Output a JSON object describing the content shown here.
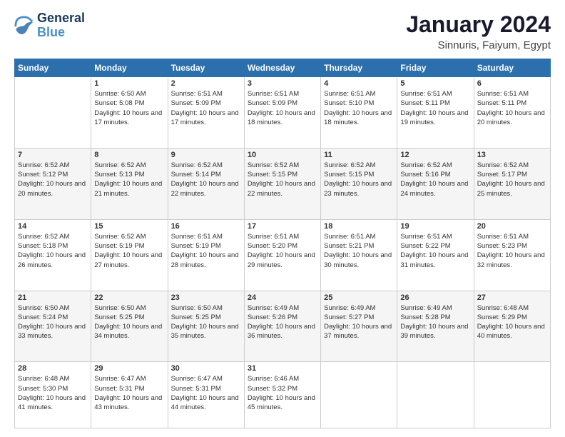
{
  "logo": {
    "line1": "General",
    "line2": "Blue"
  },
  "title": "January 2024",
  "subtitle": "Sinnuris, Faiyum, Egypt",
  "weekdays": [
    "Sunday",
    "Monday",
    "Tuesday",
    "Wednesday",
    "Thursday",
    "Friday",
    "Saturday"
  ],
  "weeks": [
    [
      {
        "day": "",
        "sunrise": "",
        "sunset": "",
        "daylight": ""
      },
      {
        "day": "1",
        "sunrise": "Sunrise: 6:50 AM",
        "sunset": "Sunset: 5:08 PM",
        "daylight": "Daylight: 10 hours and 17 minutes."
      },
      {
        "day": "2",
        "sunrise": "Sunrise: 6:51 AM",
        "sunset": "Sunset: 5:09 PM",
        "daylight": "Daylight: 10 hours and 17 minutes."
      },
      {
        "day": "3",
        "sunrise": "Sunrise: 6:51 AM",
        "sunset": "Sunset: 5:09 PM",
        "daylight": "Daylight: 10 hours and 18 minutes."
      },
      {
        "day": "4",
        "sunrise": "Sunrise: 6:51 AM",
        "sunset": "Sunset: 5:10 PM",
        "daylight": "Daylight: 10 hours and 18 minutes."
      },
      {
        "day": "5",
        "sunrise": "Sunrise: 6:51 AM",
        "sunset": "Sunset: 5:11 PM",
        "daylight": "Daylight: 10 hours and 19 minutes."
      },
      {
        "day": "6",
        "sunrise": "Sunrise: 6:51 AM",
        "sunset": "Sunset: 5:11 PM",
        "daylight": "Daylight: 10 hours and 20 minutes."
      }
    ],
    [
      {
        "day": "7",
        "sunrise": "Sunrise: 6:52 AM",
        "sunset": "Sunset: 5:12 PM",
        "daylight": "Daylight: 10 hours and 20 minutes."
      },
      {
        "day": "8",
        "sunrise": "Sunrise: 6:52 AM",
        "sunset": "Sunset: 5:13 PM",
        "daylight": "Daylight: 10 hours and 21 minutes."
      },
      {
        "day": "9",
        "sunrise": "Sunrise: 6:52 AM",
        "sunset": "Sunset: 5:14 PM",
        "daylight": "Daylight: 10 hours and 22 minutes."
      },
      {
        "day": "10",
        "sunrise": "Sunrise: 6:52 AM",
        "sunset": "Sunset: 5:15 PM",
        "daylight": "Daylight: 10 hours and 22 minutes."
      },
      {
        "day": "11",
        "sunrise": "Sunrise: 6:52 AM",
        "sunset": "Sunset: 5:15 PM",
        "daylight": "Daylight: 10 hours and 23 minutes."
      },
      {
        "day": "12",
        "sunrise": "Sunrise: 6:52 AM",
        "sunset": "Sunset: 5:16 PM",
        "daylight": "Daylight: 10 hours and 24 minutes."
      },
      {
        "day": "13",
        "sunrise": "Sunrise: 6:52 AM",
        "sunset": "Sunset: 5:17 PM",
        "daylight": "Daylight: 10 hours and 25 minutes."
      }
    ],
    [
      {
        "day": "14",
        "sunrise": "Sunrise: 6:52 AM",
        "sunset": "Sunset: 5:18 PM",
        "daylight": "Daylight: 10 hours and 26 minutes."
      },
      {
        "day": "15",
        "sunrise": "Sunrise: 6:52 AM",
        "sunset": "Sunset: 5:19 PM",
        "daylight": "Daylight: 10 hours and 27 minutes."
      },
      {
        "day": "16",
        "sunrise": "Sunrise: 6:51 AM",
        "sunset": "Sunset: 5:19 PM",
        "daylight": "Daylight: 10 hours and 28 minutes."
      },
      {
        "day": "17",
        "sunrise": "Sunrise: 6:51 AM",
        "sunset": "Sunset: 5:20 PM",
        "daylight": "Daylight: 10 hours and 29 minutes."
      },
      {
        "day": "18",
        "sunrise": "Sunrise: 6:51 AM",
        "sunset": "Sunset: 5:21 PM",
        "daylight": "Daylight: 10 hours and 30 minutes."
      },
      {
        "day": "19",
        "sunrise": "Sunrise: 6:51 AM",
        "sunset": "Sunset: 5:22 PM",
        "daylight": "Daylight: 10 hours and 31 minutes."
      },
      {
        "day": "20",
        "sunrise": "Sunrise: 6:51 AM",
        "sunset": "Sunset: 5:23 PM",
        "daylight": "Daylight: 10 hours and 32 minutes."
      }
    ],
    [
      {
        "day": "21",
        "sunrise": "Sunrise: 6:50 AM",
        "sunset": "Sunset: 5:24 PM",
        "daylight": "Daylight: 10 hours and 33 minutes."
      },
      {
        "day": "22",
        "sunrise": "Sunrise: 6:50 AM",
        "sunset": "Sunset: 5:25 PM",
        "daylight": "Daylight: 10 hours and 34 minutes."
      },
      {
        "day": "23",
        "sunrise": "Sunrise: 6:50 AM",
        "sunset": "Sunset: 5:25 PM",
        "daylight": "Daylight: 10 hours and 35 minutes."
      },
      {
        "day": "24",
        "sunrise": "Sunrise: 6:49 AM",
        "sunset": "Sunset: 5:26 PM",
        "daylight": "Daylight: 10 hours and 36 minutes."
      },
      {
        "day": "25",
        "sunrise": "Sunrise: 6:49 AM",
        "sunset": "Sunset: 5:27 PM",
        "daylight": "Daylight: 10 hours and 37 minutes."
      },
      {
        "day": "26",
        "sunrise": "Sunrise: 6:49 AM",
        "sunset": "Sunset: 5:28 PM",
        "daylight": "Daylight: 10 hours and 39 minutes."
      },
      {
        "day": "27",
        "sunrise": "Sunrise: 6:48 AM",
        "sunset": "Sunset: 5:29 PM",
        "daylight": "Daylight: 10 hours and 40 minutes."
      }
    ],
    [
      {
        "day": "28",
        "sunrise": "Sunrise: 6:48 AM",
        "sunset": "Sunset: 5:30 PM",
        "daylight": "Daylight: 10 hours and 41 minutes."
      },
      {
        "day": "29",
        "sunrise": "Sunrise: 6:47 AM",
        "sunset": "Sunset: 5:31 PM",
        "daylight": "Daylight: 10 hours and 43 minutes."
      },
      {
        "day": "30",
        "sunrise": "Sunrise: 6:47 AM",
        "sunset": "Sunset: 5:31 PM",
        "daylight": "Daylight: 10 hours and 44 minutes."
      },
      {
        "day": "31",
        "sunrise": "Sunrise: 6:46 AM",
        "sunset": "Sunset: 5:32 PM",
        "daylight": "Daylight: 10 hours and 45 minutes."
      },
      {
        "day": "",
        "sunrise": "",
        "sunset": "",
        "daylight": ""
      },
      {
        "day": "",
        "sunrise": "",
        "sunset": "",
        "daylight": ""
      },
      {
        "day": "",
        "sunrise": "",
        "sunset": "",
        "daylight": ""
      }
    ]
  ]
}
